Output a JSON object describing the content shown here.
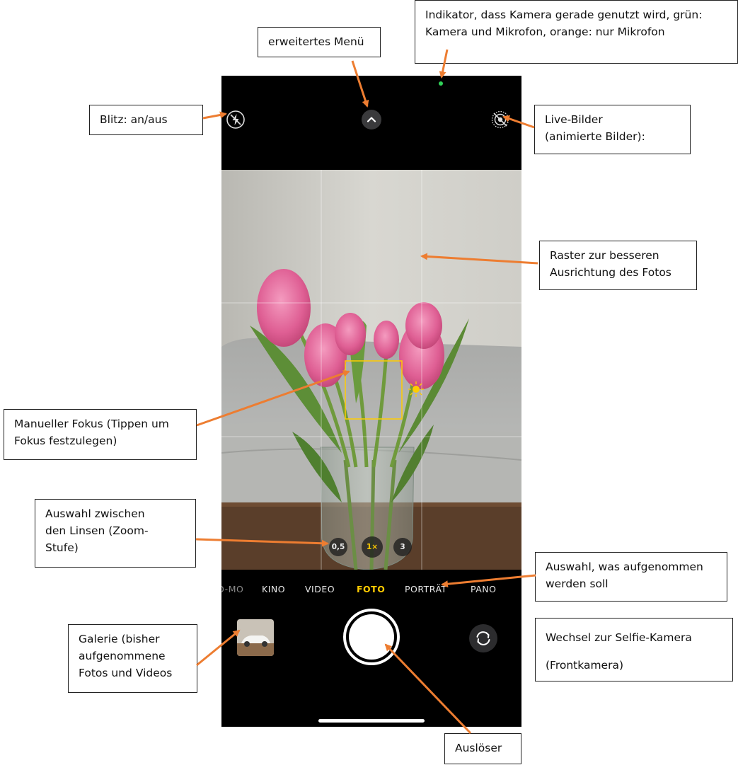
{
  "callouts": {
    "camera_indicator": {
      "line1": "Indikator, dass Kamera gerade genutzt wird, grün:",
      "line2": "Kamera und Mikrofon, orange: nur Mikrofon"
    },
    "extended_menu": "erweitertes Menü",
    "flash": "Blitz: an/aus",
    "live_photos": {
      "line1": "Live-Bilder",
      "line2": "(animierte Bilder):"
    },
    "grid": {
      "line1": "Raster zur besseren",
      "line2": "Ausrichtung des Fotos"
    },
    "manual_focus": {
      "line1": "Manueller Fokus (Tippen um",
      "line2": "Fokus festzulegen)"
    },
    "lens_selection": {
      "line1": "Auswahl zwischen",
      "line2": "den Linsen (Zoom-",
      "line3": "Stufe)"
    },
    "capture_mode": {
      "line1": "Auswahl, was aufgenommen",
      "line2": "werden soll"
    },
    "selfie": {
      "line1": "Wechsel zur Selfie-Kamera",
      "line2": "(Frontkamera)"
    },
    "gallery": {
      "line1": "Galerie (bisher",
      "line2": "aufgenommene",
      "line3": "Fotos und Videos"
    },
    "shutter": "Auslöser"
  },
  "camera": {
    "modes": [
      {
        "label": "O-MO",
        "active": false
      },
      {
        "label": "KINO",
        "active": false
      },
      {
        "label": "VIDEO",
        "active": false
      },
      {
        "label": "FOTO",
        "active": true
      },
      {
        "label": "PORTRÄT",
        "active": false
      },
      {
        "label": "PANO",
        "active": false
      }
    ],
    "lenses": [
      {
        "label": "0,5",
        "active": false
      },
      {
        "label": "1×",
        "active": true
      },
      {
        "label": "3",
        "active": false
      }
    ],
    "icons": [
      "flash-off-icon",
      "chevron-up-icon",
      "live-photo-off-icon",
      "camera-switch-icon"
    ]
  },
  "colors": {
    "accent": "#ffcc00",
    "arrow": "#ed7d31",
    "indicator": "#30d158"
  }
}
